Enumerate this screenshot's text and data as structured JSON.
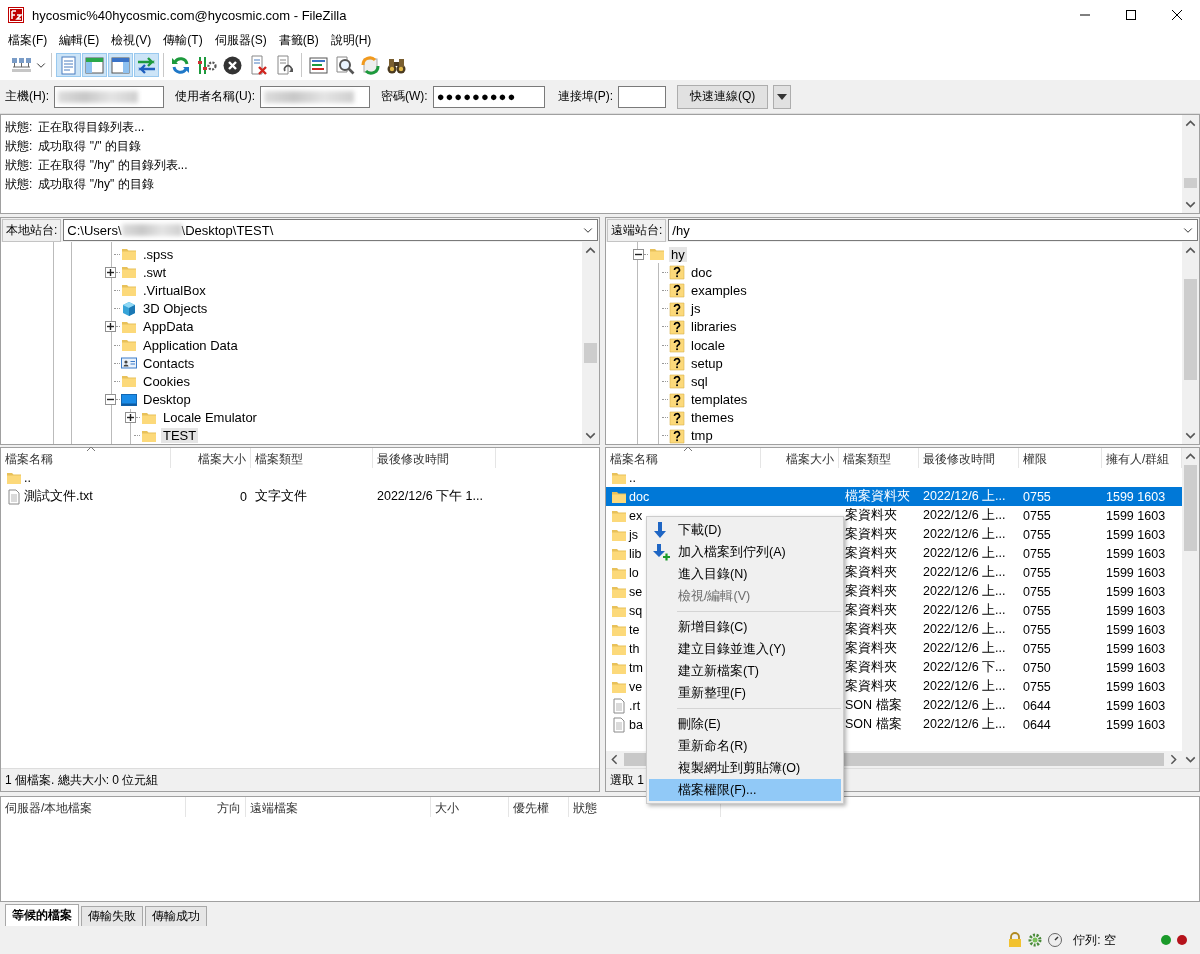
{
  "window": {
    "title": "hycosmic%40hycosmic.com@hycosmic.com - FileZilla"
  },
  "menu": [
    "檔案(F)",
    "編輯(E)",
    "檢視(V)",
    "傳輸(T)",
    "伺服器(S)",
    "書籤(B)",
    "說明(H)"
  ],
  "toolbar": {
    "groups": [
      {
        "buttons": [
          {
            "kind": "sitemanager",
            "pressed": false
          }
        ]
      },
      {
        "buttons": [
          {
            "kind": "log",
            "pressed": true
          },
          {
            "kind": "localtree",
            "pressed": true
          },
          {
            "kind": "remotetree",
            "pressed": true
          },
          {
            "kind": "queue",
            "pressed": true
          }
        ]
      },
      {
        "buttons": [
          {
            "kind": "refresh",
            "pressed": false
          },
          {
            "kind": "process",
            "pressed": false
          },
          {
            "kind": "cancel",
            "pressed": false
          },
          {
            "kind": "disconnect",
            "pressed": false
          },
          {
            "kind": "reconnect",
            "pressed": false
          }
        ]
      },
      {
        "buttons": [
          {
            "kind": "filter",
            "pressed": false
          },
          {
            "kind": "compare",
            "pressed": false
          },
          {
            "kind": "sync",
            "pressed": false
          },
          {
            "kind": "find",
            "pressed": false
          }
        ]
      }
    ]
  },
  "quickconnect": {
    "host": {
      "label": "主機(H):",
      "blurred": true
    },
    "username": {
      "label": "使用者名稱(U):",
      "blurred": true
    },
    "password": {
      "label": "密碼(W):",
      "value": "●●●●●●●●●"
    },
    "port": {
      "label": "連接埠(P):"
    },
    "connect_button": "快速連線(Q)"
  },
  "log": [
    {
      "label": "狀態:",
      "text": "正在取得目錄列表..."
    },
    {
      "label": "狀態:",
      "text": "成功取得 \"/\" 的目錄"
    },
    {
      "label": "狀態:",
      "text": "正在取得 \"/hy\" 的目錄列表..."
    },
    {
      "label": "狀態:",
      "text": "成功取得 \"/hy\" 的目錄"
    }
  ],
  "local": {
    "site_label": "本地站台:",
    "path_start": "C:\\Users\\",
    "path_blurred": true,
    "path_end": "\\Desktop\\TEST\\",
    "tree": [
      {
        "label": ".spss",
        "kind": "folder",
        "has_children": false,
        "expanded": false,
        "selected": false
      },
      {
        "label": ".swt",
        "kind": "folder",
        "has_children": true,
        "expanded": false,
        "selected": false
      },
      {
        "label": ".VirtualBox",
        "kind": "folder",
        "has_children": false,
        "expanded": false,
        "selected": false
      },
      {
        "label": "3D Objects",
        "kind": "cube",
        "has_children": false,
        "expanded": false,
        "selected": false
      },
      {
        "label": "AppData",
        "kind": "folder",
        "has_children": true,
        "expanded": false,
        "selected": false
      },
      {
        "label": "Application Data",
        "kind": "folder",
        "has_children": false,
        "expanded": false,
        "selected": false
      },
      {
        "label": "Contacts",
        "kind": "contacts",
        "has_children": false,
        "expanded": false,
        "selected": false
      },
      {
        "label": "Cookies",
        "kind": "folder",
        "has_children": false,
        "expanded": false,
        "selected": false
      },
      {
        "label": "Desktop",
        "kind": "desktop",
        "has_children": true,
        "expanded": true,
        "selected": false,
        "children": [
          {
            "label": "Locale Emulator",
            "kind": "folder",
            "has_children": true,
            "expanded": false,
            "selected": false
          },
          {
            "label": "TEST",
            "kind": "folder",
            "has_children": false,
            "expanded": false,
            "selected": true
          }
        ]
      }
    ],
    "columns": [
      {
        "label": "檔案名稱",
        "sorted": true
      },
      {
        "label": "檔案大小",
        "sorted": false
      },
      {
        "label": "檔案類型",
        "sorted": false
      },
      {
        "label": "最後修改時間",
        "sorted": false
      }
    ],
    "rows": [
      {
        "kind": "parent",
        "name": "..",
        "size": "",
        "type": "",
        "modified": ""
      },
      {
        "kind": "file",
        "name": "測試文件.txt",
        "size": "0",
        "type": "文字文件",
        "modified": "2022/12/6 下午 1..."
      }
    ],
    "status": "1 個檔案. 總共大小: 0 位元組"
  },
  "remote": {
    "site_label": "遠端站台:",
    "path": "/hy",
    "tree": [
      {
        "label": "hy",
        "kind": "folder",
        "has_children": true,
        "expanded": true,
        "selected": true,
        "children": [
          {
            "label": "doc",
            "kind": "unknown",
            "has_children": false,
            "expanded": false,
            "selected": false
          },
          {
            "label": "examples",
            "kind": "unknown",
            "has_children": false,
            "expanded": false,
            "selected": false
          },
          {
            "label": "js",
            "kind": "unknown",
            "has_children": false,
            "expanded": false,
            "selected": false
          },
          {
            "label": "libraries",
            "kind": "unknown",
            "has_children": false,
            "expanded": false,
            "selected": false
          },
          {
            "label": "locale",
            "kind": "unknown",
            "has_children": false,
            "expanded": false,
            "selected": false
          },
          {
            "label": "setup",
            "kind": "unknown",
            "has_children": false,
            "expanded": false,
            "selected": false
          },
          {
            "label": "sql",
            "kind": "unknown",
            "has_children": false,
            "expanded": false,
            "selected": false
          },
          {
            "label": "templates",
            "kind": "unknown",
            "has_children": false,
            "expanded": false,
            "selected": false
          },
          {
            "label": "themes",
            "kind": "unknown",
            "has_children": false,
            "expanded": false,
            "selected": false
          },
          {
            "label": "tmp",
            "kind": "unknown",
            "has_children": false,
            "expanded": false,
            "selected": false
          }
        ]
      }
    ],
    "columns": [
      {
        "label": "檔案名稱",
        "sorted": true
      },
      {
        "label": "檔案大小",
        "sorted": false
      },
      {
        "label": "檔案類型",
        "sorted": false
      },
      {
        "label": "最後修改時間",
        "sorted": false
      },
      {
        "label": "權限",
        "sorted": false
      },
      {
        "label": "擁有人/群組",
        "sorted": false
      }
    ],
    "rows": [
      {
        "kind": "parent",
        "name": "..",
        "type": "",
        "modified": "",
        "permissions": "",
        "owner": "",
        "selected": false
      },
      {
        "kind": "folder",
        "name": "doc",
        "type": "檔案資料夾",
        "modified": "2022/12/6 上...",
        "permissions": "0755",
        "owner": "1599 1603",
        "selected": true
      },
      {
        "kind": "folder",
        "name": "ex",
        "type": "案資料夾",
        "modified": "2022/12/6 上...",
        "permissions": "0755",
        "owner": "1599 1603",
        "selected": false
      },
      {
        "kind": "folder",
        "name": "js",
        "type": "案資料夾",
        "modified": "2022/12/6 上...",
        "permissions": "0755",
        "owner": "1599 1603",
        "selected": false
      },
      {
        "kind": "folder",
        "name": "lib",
        "type": "案資料夾",
        "modified": "2022/12/6 上...",
        "permissions": "0755",
        "owner": "1599 1603",
        "selected": false
      },
      {
        "kind": "folder",
        "name": "lo",
        "type": "案資料夾",
        "modified": "2022/12/6 上...",
        "permissions": "0755",
        "owner": "1599 1603",
        "selected": false
      },
      {
        "kind": "folder",
        "name": "se",
        "type": "案資料夾",
        "modified": "2022/12/6 上...",
        "permissions": "0755",
        "owner": "1599 1603",
        "selected": false
      },
      {
        "kind": "folder",
        "name": "sq",
        "type": "案資料夾",
        "modified": "2022/12/6 上...",
        "permissions": "0755",
        "owner": "1599 1603",
        "selected": false
      },
      {
        "kind": "folder",
        "name": "te",
        "type": "案資料夾",
        "modified": "2022/12/6 上...",
        "permissions": "0755",
        "owner": "1599 1603",
        "selected": false
      },
      {
        "kind": "folder",
        "name": "th",
        "type": "案資料夾",
        "modified": "2022/12/6 上...",
        "permissions": "0755",
        "owner": "1599 1603",
        "selected": false
      },
      {
        "kind": "folder",
        "name": "tm",
        "type": "案資料夾",
        "modified": "2022/12/6 下...",
        "permissions": "0750",
        "owner": "1599 1603",
        "selected": false
      },
      {
        "kind": "folder",
        "name": "ve",
        "type": "案資料夾",
        "modified": "2022/12/6 上...",
        "permissions": "0755",
        "owner": "1599 1603",
        "selected": false
      },
      {
        "kind": "file",
        "name": ".rt",
        "type": "SON 檔案",
        "modified": "2022/12/6 上...",
        "permissions": "0644",
        "owner": "1599 1603",
        "selected": false
      },
      {
        "kind": "file",
        "name": "ba",
        "type": "SON 檔案",
        "modified": "2022/12/6 上...",
        "permissions": "0644",
        "owner": "1599 1603",
        "selected": false
      }
    ],
    "status": "選取 1"
  },
  "context_menu": [
    {
      "kind": "download",
      "label": "下載(D)",
      "disabled": false,
      "selected": false
    },
    {
      "kind": "enqueue",
      "label": "加入檔案到佇列(A)",
      "disabled": false,
      "selected": false
    },
    {
      "kind": "plain",
      "label": "進入目錄(N)",
      "disabled": false,
      "selected": false
    },
    {
      "kind": "plain",
      "label": "檢視/編輯(V)",
      "disabled": true,
      "selected": false
    },
    {
      "kind": "separator"
    },
    {
      "kind": "plain",
      "label": "新增目錄(C)",
      "disabled": false,
      "selected": false
    },
    {
      "kind": "plain",
      "label": "建立目錄並進入(Y)",
      "disabled": false,
      "selected": false
    },
    {
      "kind": "plain",
      "label": "建立新檔案(T)",
      "disabled": false,
      "selected": false
    },
    {
      "kind": "plain",
      "label": "重新整理(F)",
      "disabled": false,
      "selected": false
    },
    {
      "kind": "separator"
    },
    {
      "kind": "plain",
      "label": "刪除(E)",
      "disabled": false,
      "selected": false
    },
    {
      "kind": "plain",
      "label": "重新命名(R)",
      "disabled": false,
      "selected": false
    },
    {
      "kind": "plain",
      "label": "複製網址到剪貼簿(O)",
      "disabled": false,
      "selected": false
    },
    {
      "kind": "plain",
      "label": "檔案權限(F)...",
      "disabled": false,
      "selected": true
    }
  ],
  "queue": {
    "columns": [
      "伺服器/本地檔案",
      "方向",
      "遠端檔案",
      "大小",
      "優先權",
      "狀態"
    ],
    "tabs": [
      {
        "label": "等候的檔案",
        "selected": true
      },
      {
        "label": "傳輸失敗",
        "selected": false
      },
      {
        "label": "傳輸成功",
        "selected": false
      }
    ]
  },
  "status_bar": {
    "queue": "佇列: 空"
  }
}
